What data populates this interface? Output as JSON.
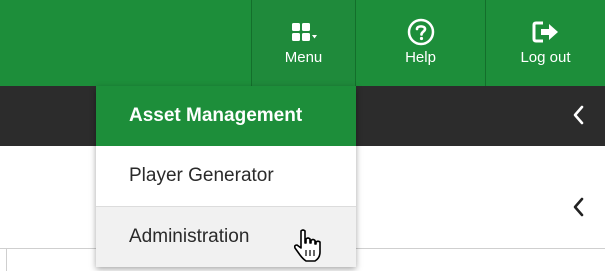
{
  "topbar": {
    "menu_label": "Menu",
    "help_label": "Help",
    "logout_label": "Log out"
  },
  "icons": {
    "menu": "grid-menu-icon",
    "help": "question-circle-icon",
    "logout": "logout-icon",
    "chevron": "chevron-left-icon",
    "cursor": "hand-pointer-cursor"
  },
  "dropdown": {
    "items": [
      {
        "label": "Asset Management",
        "active": true
      },
      {
        "label": "Player Generator",
        "active": false
      },
      {
        "label": "Administration",
        "active": false,
        "hovered": true
      }
    ]
  },
  "colors": {
    "primary": "#1d8e3a",
    "dark_band": "#2c2c2c"
  }
}
